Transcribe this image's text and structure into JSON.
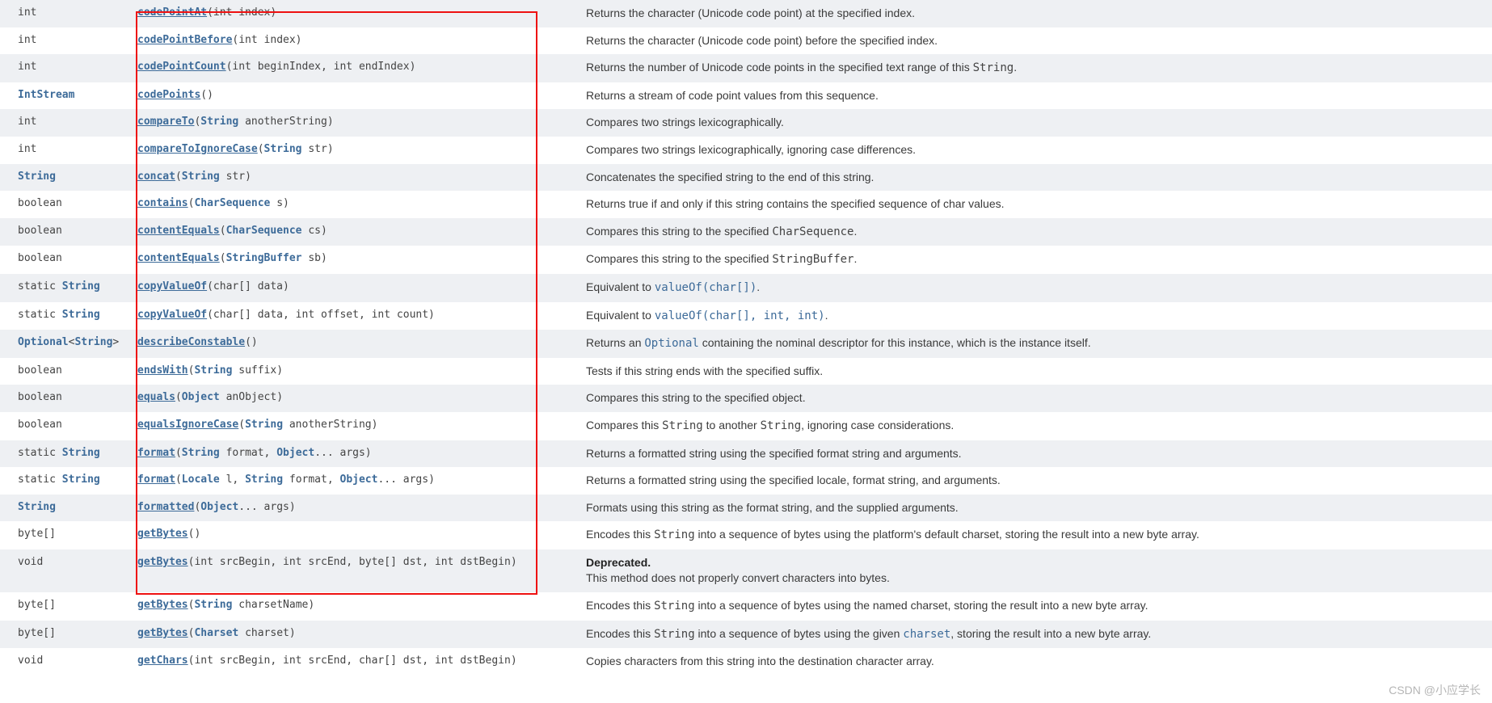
{
  "watermark": "CSDN @小应学长",
  "rows": [
    {
      "return": [
        {
          "t": "kw",
          "v": "int"
        }
      ],
      "method": [
        {
          "t": "m",
          "v": "codePointAt"
        },
        {
          "t": "p",
          "v": "("
        },
        {
          "t": "kw",
          "v": "int"
        },
        {
          "t": "p",
          "v": " index)"
        }
      ],
      "desc": [
        {
          "t": "txt",
          "v": "Returns the character (Unicode code point) at the specified index."
        }
      ]
    },
    {
      "return": [
        {
          "t": "kw",
          "v": "int"
        }
      ],
      "method": [
        {
          "t": "m",
          "v": "codePointBefore"
        },
        {
          "t": "p",
          "v": "("
        },
        {
          "t": "kw",
          "v": "int"
        },
        {
          "t": "p",
          "v": " index)"
        }
      ],
      "desc": [
        {
          "t": "txt",
          "v": "Returns the character (Unicode code point) before the specified index."
        }
      ]
    },
    {
      "return": [
        {
          "t": "kw",
          "v": "int"
        }
      ],
      "method": [
        {
          "t": "m",
          "v": "codePointCount"
        },
        {
          "t": "p",
          "v": "("
        },
        {
          "t": "kw",
          "v": "int"
        },
        {
          "t": "p",
          "v": " beginIndex, "
        },
        {
          "t": "kw",
          "v": "int"
        },
        {
          "t": "p",
          "v": " endIndex)"
        }
      ],
      "desc": [
        {
          "t": "txt",
          "v": "Returns the number of Unicode code points in the specified text range of this "
        },
        {
          "t": "code",
          "v": "String"
        },
        {
          "t": "txt",
          "v": "."
        }
      ]
    },
    {
      "return": [
        {
          "t": "link",
          "v": "IntStream"
        }
      ],
      "method": [
        {
          "t": "m",
          "v": "codePoints"
        },
        {
          "t": "p",
          "v": "()"
        }
      ],
      "desc": [
        {
          "t": "txt",
          "v": "Returns a stream of code point values from this sequence."
        }
      ]
    },
    {
      "return": [
        {
          "t": "kw",
          "v": "int"
        }
      ],
      "method": [
        {
          "t": "m",
          "v": "compareTo"
        },
        {
          "t": "p",
          "v": "("
        },
        {
          "t": "link",
          "v": "String"
        },
        {
          "t": "p",
          "v": " anotherString)"
        }
      ],
      "desc": [
        {
          "t": "txt",
          "v": "Compares two strings lexicographically."
        }
      ]
    },
    {
      "return": [
        {
          "t": "kw",
          "v": "int"
        }
      ],
      "method": [
        {
          "t": "m",
          "v": "compareToIgnoreCase"
        },
        {
          "t": "p",
          "v": "("
        },
        {
          "t": "link",
          "v": "String"
        },
        {
          "t": "p",
          "v": " str)"
        }
      ],
      "desc": [
        {
          "t": "txt",
          "v": "Compares two strings lexicographically, ignoring case differences."
        }
      ]
    },
    {
      "return": [
        {
          "t": "link",
          "v": "String"
        }
      ],
      "method": [
        {
          "t": "m",
          "v": "concat"
        },
        {
          "t": "p",
          "v": "("
        },
        {
          "t": "link",
          "v": "String"
        },
        {
          "t": "p",
          "v": " str)"
        }
      ],
      "desc": [
        {
          "t": "txt",
          "v": "Concatenates the specified string to the end of this string."
        }
      ]
    },
    {
      "return": [
        {
          "t": "kw",
          "v": "boolean"
        }
      ],
      "method": [
        {
          "t": "m",
          "v": "contains"
        },
        {
          "t": "p",
          "v": "("
        },
        {
          "t": "link",
          "v": "CharSequence"
        },
        {
          "t": "p",
          "v": " s)"
        }
      ],
      "desc": [
        {
          "t": "txt",
          "v": "Returns true if and only if this string contains the specified sequence of char values."
        }
      ]
    },
    {
      "return": [
        {
          "t": "kw",
          "v": "boolean"
        }
      ],
      "method": [
        {
          "t": "m",
          "v": "contentEquals"
        },
        {
          "t": "p",
          "v": "("
        },
        {
          "t": "link",
          "v": "CharSequence"
        },
        {
          "t": "p",
          "v": " cs)"
        }
      ],
      "desc": [
        {
          "t": "txt",
          "v": "Compares this string to the specified "
        },
        {
          "t": "code",
          "v": "CharSequence"
        },
        {
          "t": "txt",
          "v": "."
        }
      ]
    },
    {
      "return": [
        {
          "t": "kw",
          "v": "boolean"
        }
      ],
      "method": [
        {
          "t": "m",
          "v": "contentEquals"
        },
        {
          "t": "p",
          "v": "("
        },
        {
          "t": "link",
          "v": "StringBuffer"
        },
        {
          "t": "p",
          "v": " sb)"
        }
      ],
      "desc": [
        {
          "t": "txt",
          "v": "Compares this string to the specified "
        },
        {
          "t": "code",
          "v": "StringBuffer"
        },
        {
          "t": "txt",
          "v": "."
        }
      ]
    },
    {
      "return": [
        {
          "t": "kw",
          "v": "static "
        },
        {
          "t": "link",
          "v": "String"
        }
      ],
      "method": [
        {
          "t": "m",
          "v": "copyValueOf"
        },
        {
          "t": "p",
          "v": "(char[] data)"
        }
      ],
      "desc": [
        {
          "t": "txt",
          "v": "Equivalent to "
        },
        {
          "t": "linkplain",
          "v": "valueOf(char[])"
        },
        {
          "t": "txt",
          "v": "."
        }
      ]
    },
    {
      "return": [
        {
          "t": "kw",
          "v": "static "
        },
        {
          "t": "link",
          "v": "String"
        }
      ],
      "method": [
        {
          "t": "m",
          "v": "copyValueOf"
        },
        {
          "t": "p",
          "v": "(char[] data, "
        },
        {
          "t": "kw",
          "v": "int"
        },
        {
          "t": "p",
          "v": " offset, "
        },
        {
          "t": "kw",
          "v": "int"
        },
        {
          "t": "p",
          "v": " count)"
        }
      ],
      "desc": [
        {
          "t": "txt",
          "v": "Equivalent to "
        },
        {
          "t": "linkplain",
          "v": "valueOf(char[], int, int)"
        },
        {
          "t": "txt",
          "v": "."
        }
      ]
    },
    {
      "return": [
        {
          "t": "link",
          "v": "Optional"
        },
        {
          "t": "kw",
          "v": "<"
        },
        {
          "t": "link",
          "v": "String"
        },
        {
          "t": "kw",
          "v": ">"
        }
      ],
      "method": [
        {
          "t": "m",
          "v": "describeConstable"
        },
        {
          "t": "p",
          "v": "()"
        }
      ],
      "desc": [
        {
          "t": "txt",
          "v": "Returns an "
        },
        {
          "t": "linkplain",
          "v": "Optional"
        },
        {
          "t": "txt",
          "v": " containing the nominal descriptor for this instance, which is the instance itself."
        }
      ]
    },
    {
      "return": [
        {
          "t": "kw",
          "v": "boolean"
        }
      ],
      "method": [
        {
          "t": "m",
          "v": "endsWith"
        },
        {
          "t": "p",
          "v": "("
        },
        {
          "t": "link",
          "v": "String"
        },
        {
          "t": "p",
          "v": " suffix)"
        }
      ],
      "desc": [
        {
          "t": "txt",
          "v": "Tests if this string ends with the specified suffix."
        }
      ]
    },
    {
      "return": [
        {
          "t": "kw",
          "v": "boolean"
        }
      ],
      "method": [
        {
          "t": "m",
          "v": "equals"
        },
        {
          "t": "p",
          "v": "("
        },
        {
          "t": "link",
          "v": "Object"
        },
        {
          "t": "p",
          "v": " anObject)"
        }
      ],
      "desc": [
        {
          "t": "txt",
          "v": "Compares this string to the specified object."
        }
      ]
    },
    {
      "return": [
        {
          "t": "kw",
          "v": "boolean"
        }
      ],
      "method": [
        {
          "t": "m",
          "v": "equalsIgnoreCase"
        },
        {
          "t": "p",
          "v": "("
        },
        {
          "t": "link",
          "v": "String"
        },
        {
          "t": "p",
          "v": " anotherString)"
        }
      ],
      "desc": [
        {
          "t": "txt",
          "v": "Compares this "
        },
        {
          "t": "code",
          "v": "String"
        },
        {
          "t": "txt",
          "v": " to another "
        },
        {
          "t": "code",
          "v": "String"
        },
        {
          "t": "txt",
          "v": ", ignoring case considerations."
        }
      ]
    },
    {
      "return": [
        {
          "t": "kw",
          "v": "static "
        },
        {
          "t": "link",
          "v": "String"
        }
      ],
      "method": [
        {
          "t": "m",
          "v": "format"
        },
        {
          "t": "p",
          "v": "("
        },
        {
          "t": "link",
          "v": "String"
        },
        {
          "t": "p",
          "v": " format, "
        },
        {
          "t": "link",
          "v": "Object"
        },
        {
          "t": "p",
          "v": "... args)"
        }
      ],
      "desc": [
        {
          "t": "txt",
          "v": "Returns a formatted string using the specified format string and arguments."
        }
      ]
    },
    {
      "return": [
        {
          "t": "kw",
          "v": "static "
        },
        {
          "t": "link",
          "v": "String"
        }
      ],
      "method": [
        {
          "t": "m",
          "v": "format"
        },
        {
          "t": "p",
          "v": "("
        },
        {
          "t": "link",
          "v": "Locale"
        },
        {
          "t": "p",
          "v": " l, "
        },
        {
          "t": "link",
          "v": "String"
        },
        {
          "t": "p",
          "v": " format, "
        },
        {
          "t": "link",
          "v": "Object"
        },
        {
          "t": "p",
          "v": "... args)"
        }
      ],
      "desc": [
        {
          "t": "txt",
          "v": "Returns a formatted string using the specified locale, format string, and arguments."
        }
      ]
    },
    {
      "return": [
        {
          "t": "link",
          "v": "String"
        }
      ],
      "method": [
        {
          "t": "m",
          "v": "formatted"
        },
        {
          "t": "p",
          "v": "("
        },
        {
          "t": "link",
          "v": "Object"
        },
        {
          "t": "p",
          "v": "... args)"
        }
      ],
      "desc": [
        {
          "t": "txt",
          "v": "Formats using this string as the format string, and the supplied arguments."
        }
      ]
    },
    {
      "return": [
        {
          "t": "kw",
          "v": "byte[]"
        }
      ],
      "method": [
        {
          "t": "m",
          "v": "getBytes"
        },
        {
          "t": "p",
          "v": "()"
        }
      ],
      "desc": [
        {
          "t": "txt",
          "v": "Encodes this "
        },
        {
          "t": "code",
          "v": "String"
        },
        {
          "t": "txt",
          "v": " into a sequence of bytes using the platform's default charset, storing the result into a new byte array."
        }
      ]
    },
    {
      "return": [
        {
          "t": "kw",
          "v": "void"
        }
      ],
      "method": [
        {
          "t": "m",
          "v": "getBytes"
        },
        {
          "t": "p",
          "v": "("
        },
        {
          "t": "kw",
          "v": "int"
        },
        {
          "t": "p",
          "v": " srcBegin, "
        },
        {
          "t": "kw",
          "v": "int"
        },
        {
          "t": "p",
          "v": " srcEnd, byte[] dst, "
        },
        {
          "t": "kw",
          "v": "int"
        },
        {
          "t": "p",
          "v": " dstBegin)"
        }
      ],
      "desc": [
        {
          "t": "dep",
          "v": "Deprecated."
        },
        {
          "t": "br",
          "v": ""
        },
        {
          "t": "txt",
          "v": "This method does not properly convert characters into bytes."
        }
      ]
    },
    {
      "return": [
        {
          "t": "kw",
          "v": "byte[]"
        }
      ],
      "method": [
        {
          "t": "m",
          "v": "getBytes"
        },
        {
          "t": "p",
          "v": "("
        },
        {
          "t": "link",
          "v": "String"
        },
        {
          "t": "p",
          "v": " charsetName)"
        }
      ],
      "desc": [
        {
          "t": "txt",
          "v": "Encodes this "
        },
        {
          "t": "code",
          "v": "String"
        },
        {
          "t": "txt",
          "v": " into a sequence of bytes using the named charset, storing the result into a new byte array."
        }
      ]
    },
    {
      "return": [
        {
          "t": "kw",
          "v": "byte[]"
        }
      ],
      "method": [
        {
          "t": "m",
          "v": "getBytes"
        },
        {
          "t": "p",
          "v": "("
        },
        {
          "t": "link",
          "v": "Charset"
        },
        {
          "t": "p",
          "v": " charset)"
        }
      ],
      "desc": [
        {
          "t": "txt",
          "v": "Encodes this "
        },
        {
          "t": "code",
          "v": "String"
        },
        {
          "t": "txt",
          "v": " into a sequence of bytes using the given "
        },
        {
          "t": "linkplain",
          "v": "charset"
        },
        {
          "t": "txt",
          "v": ", storing the result into a new byte array."
        }
      ]
    },
    {
      "return": [
        {
          "t": "kw",
          "v": "void"
        }
      ],
      "method": [
        {
          "t": "m",
          "v": "getChars"
        },
        {
          "t": "p",
          "v": "("
        },
        {
          "t": "kw",
          "v": "int"
        },
        {
          "t": "p",
          "v": " srcBegin, "
        },
        {
          "t": "kw",
          "v": "int"
        },
        {
          "t": "p",
          "v": " srcEnd, char[] dst, "
        },
        {
          "t": "kw",
          "v": "int"
        },
        {
          "t": "p",
          "v": " dstBegin)"
        }
      ],
      "desc": [
        {
          "t": "txt",
          "v": "Copies characters from this string into the destination character array."
        }
      ]
    }
  ]
}
